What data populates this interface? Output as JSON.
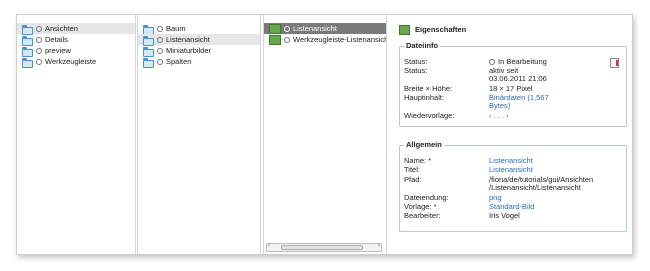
{
  "column1": {
    "items": [
      {
        "label": "Ansichten",
        "selected": true
      },
      {
        "label": "Details"
      },
      {
        "label": "preview"
      },
      {
        "label": "Werkzeugleiste"
      }
    ]
  },
  "column2": {
    "items": [
      {
        "label": "Baum"
      },
      {
        "label": "Listenansicht",
        "selected": true
      },
      {
        "label": "Miniaturbilder"
      },
      {
        "label": "Spalten"
      }
    ]
  },
  "column3": {
    "items": [
      {
        "label": "Listenansicht",
        "selected": true
      },
      {
        "label": "Werkzeugleiste-Listenansicht"
      }
    ]
  },
  "properties": {
    "title": "Eigenschaften",
    "fileinfo": {
      "legend": "Dateiinfo",
      "status_label": "Status:",
      "status_value": "In Bearbeitung",
      "status2_label": "Status:",
      "status2_line1": "aktiv seit",
      "status2_line2": "03.06.2011 21:06",
      "size_label": "Breite × Höhe:",
      "size_value": "18 × 17 Pixel",
      "content_label": "Hauptinhalt:",
      "content_line1": "Binärdaten (1,567",
      "content_line2": "Bytes)",
      "resubmit_label": "Wiedervorlage:",
      "resubmit_value": "‹ . . . ›"
    },
    "general": {
      "legend": "Allgemein",
      "name_label": "Name: *",
      "name_value": "Listenansicht",
      "title_label": "Titel:",
      "title_value": "Listenansicht",
      "path_label": "Pfad:",
      "path_line1": "/fiona/de/tutorials/gui/Ansichten",
      "path_line2": "/Listenansicht/Listenansicht",
      "ext_label": "Dateiendung:",
      "ext_value": "png",
      "template_label": "Vorlage: *",
      "template_value": "Standard-Bild",
      "editor_label": "Bearbeiter:",
      "editor_value": "Iris Vogel"
    }
  },
  "colors": {
    "link": "#2c6cb8",
    "selected_dark": "#7a7a7a",
    "selected_light": "#e6e6e6",
    "folder": "#4e8fcf"
  },
  "icons": [
    "folder-icon",
    "image-icon",
    "pdf-icon",
    "radio-icon"
  ]
}
